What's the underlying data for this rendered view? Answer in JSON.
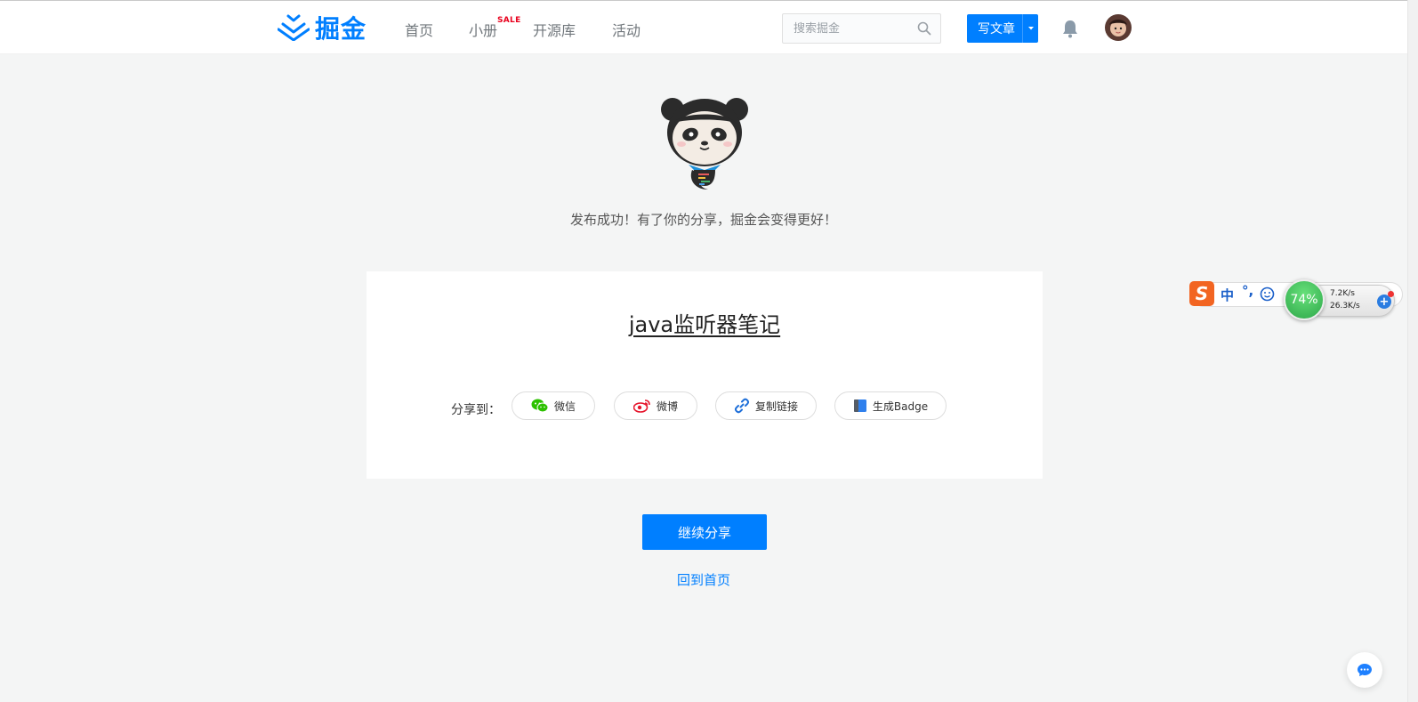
{
  "header": {
    "logo_text": "掘金",
    "nav": [
      {
        "label": "首页"
      },
      {
        "label": "小册",
        "badge": "SALE"
      },
      {
        "label": "开源库"
      },
      {
        "label": "活动"
      }
    ],
    "search_placeholder": "搜索掘金",
    "write_label": "写文章"
  },
  "main": {
    "success_message": "发布成功！有了你的分享，掘金会变得更好！",
    "article_title": "java监听器笔记",
    "share_label": "分享到：",
    "share_options": [
      {
        "label": "微信",
        "icon": "wechat-icon"
      },
      {
        "label": "微博",
        "icon": "weibo-icon"
      },
      {
        "label": "复制链接",
        "icon": "link-icon"
      },
      {
        "label": "生成Badge",
        "icon": "badge-icon"
      }
    ],
    "continue_label": "继续分享",
    "home_label": "回到首页"
  },
  "widget": {
    "ime_logo": "S",
    "ime_mode": "中",
    "ime_punct": "°,",
    "cpu_percent": "74%",
    "upload_speed": "7.2K/s",
    "download_speed": "26.3K/s"
  },
  "colors": {
    "brand": "#007fff",
    "background": "#f4f5f5",
    "card": "#ffffff"
  }
}
